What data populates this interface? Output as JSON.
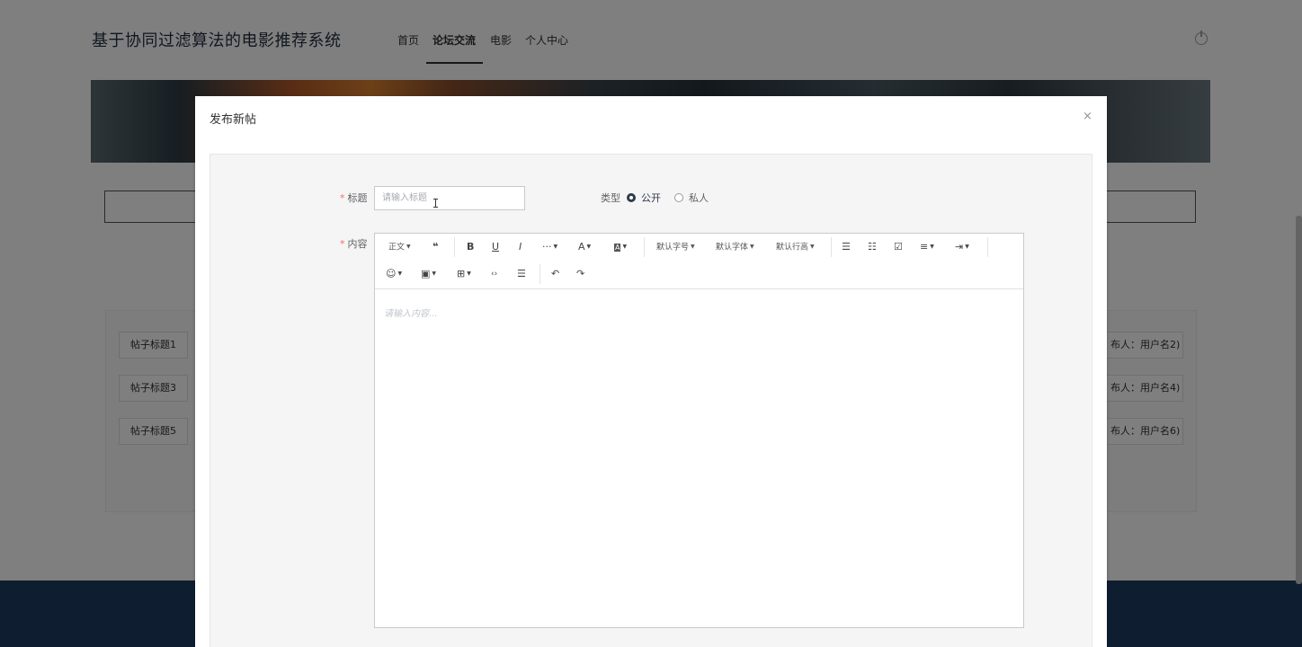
{
  "site": {
    "title": "基于协同过滤算法的电影推荐系统",
    "nav": [
      "首页",
      "论坛交流",
      "电影",
      "个人中心"
    ],
    "active_nav": "论坛交流"
  },
  "posts": [
    {
      "title": "帖子标题1",
      "publisher": "布人：用户名2)"
    },
    {
      "title": "帖子标题3",
      "publisher": "布人：用户名4)"
    },
    {
      "title": "帖子标题5",
      "publisher": "布人：用户名6)"
    }
  ],
  "dialog": {
    "title": "发布新帖",
    "close_icon": "×",
    "form": {
      "title_label": "标题",
      "title_placeholder": "请输入标题",
      "title_value": "",
      "type_label": "类型",
      "type_options": [
        "公开",
        "私人"
      ],
      "type_selected": "公开",
      "content_label": "内容",
      "content_placeholder": "请输入内容..."
    },
    "toolbar": {
      "paragraph": "正文",
      "quote": "❝",
      "bold": "B",
      "underline": "U",
      "italic": "I",
      "more": "···",
      "font_color": "A",
      "bg_color": "A",
      "font_size": "默认字号",
      "font_family": "默认字体",
      "line_height": "默认行高",
      "bullet_list": "☰",
      "numbered_list": "☷",
      "todo": "☑",
      "align": "≡",
      "indent": "⇥",
      "emoji": "☺",
      "image": "▣",
      "table": "⊞",
      "code": "‹›",
      "divider": "☰",
      "undo": "↶",
      "redo": "↷"
    }
  }
}
